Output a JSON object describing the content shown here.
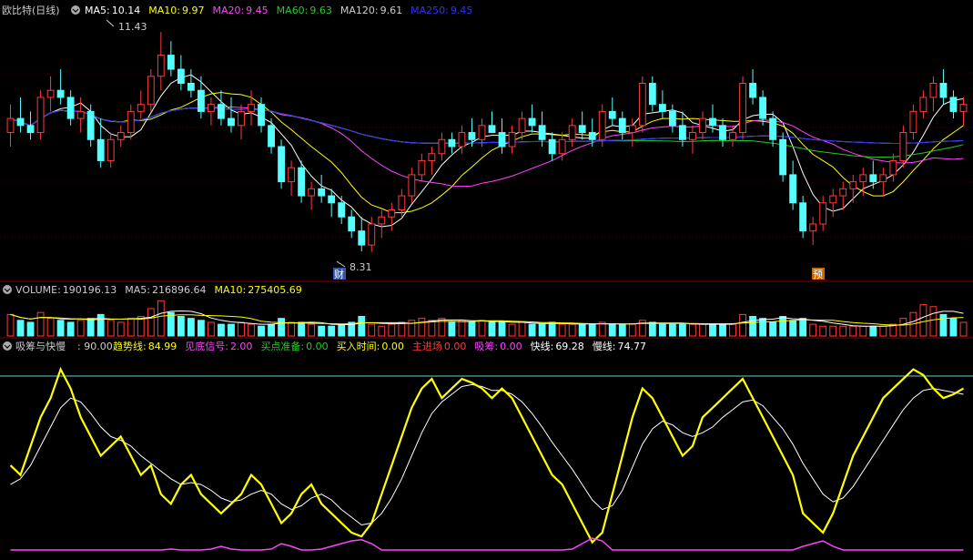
{
  "colors": {
    "up": "#ff3a3a",
    "down": "#54ffff",
    "ma5": "#ffffff",
    "ma10": "#ffff00",
    "ma20": "#ff44ff",
    "ma60": "#22cc22",
    "ma120": "#cccccc",
    "ma250": "#3030ff",
    "fast": "#ffff00",
    "slow": "#ffffff",
    "volume_line1": "#ffffff",
    "volume_line2": "#ffff00",
    "grid": "#800000",
    "hline": "#66cccc"
  },
  "price_panel": {
    "title": "欧比特(日线)",
    "indicators": [
      {
        "label": "MA5:",
        "value": "10.14",
        "color": "#ffffff"
      },
      {
        "label": "MA10:",
        "value": "9.97",
        "color": "#ffff00"
      },
      {
        "label": "MA20:",
        "value": "9.45",
        "color": "#ff44ff"
      },
      {
        "label": "MA60:",
        "value": "9.63",
        "color": "#22cc22"
      },
      {
        "label": "MA120:",
        "value": "9.61",
        "color": "#cccccc"
      },
      {
        "label": "MA250:",
        "value": "9.45",
        "color": "#3030ff"
      }
    ],
    "high_label": "11.43",
    "low_label": "8.31",
    "marker_cai": "财",
    "marker_yu": "预"
  },
  "volume_panel": {
    "indicators": [
      {
        "label": "VOLUME:",
        "value": "190196.13",
        "color": "#cccccc"
      },
      {
        "label": "MA5:",
        "value": "216896.64",
        "color": "#cccccc"
      },
      {
        "label": "MA10:",
        "value": "275405.69",
        "color": "#ffff00"
      }
    ]
  },
  "signal_panel": {
    "title": "吸筹与快慢",
    "title_value": ": 90.00",
    "indicators": [
      {
        "label": "趋势线:",
        "value": "84.99",
        "color": "#ffff00"
      },
      {
        "label": "见底信号:",
        "value": "2.00",
        "color": "#ff44ff"
      },
      {
        "label": "买点准备:",
        "value": "0.00",
        "color": "#22cc22"
      },
      {
        "label": "买入时间:",
        "value": "0.00",
        "color": "#ffff00"
      },
      {
        "label": "主进场",
        "value": "0.00",
        "color": "#ff3a3a"
      },
      {
        "label": "吸筹:",
        "value": "0.00",
        "color": "#ff44ff"
      },
      {
        "label": "快线:",
        "value": "69.28",
        "color": "#ffffff"
      },
      {
        "label": "慢线:",
        "value": "74.77",
        "color": "#ffffff"
      }
    ]
  },
  "chart_data": {
    "type": "candlestick",
    "price_range": [
      8.0,
      11.6
    ],
    "high": 11.43,
    "low": 8.31,
    "candles": [
      [
        10.0,
        10.4,
        9.8,
        10.2
      ],
      [
        10.2,
        10.5,
        10.0,
        10.1
      ],
      [
        10.1,
        10.3,
        9.9,
        10.0
      ],
      [
        10.0,
        10.6,
        9.9,
        10.5
      ],
      [
        10.5,
        10.8,
        10.3,
        10.6
      ],
      [
        10.6,
        10.9,
        10.4,
        10.5
      ],
      [
        10.5,
        10.6,
        10.1,
        10.2
      ],
      [
        10.2,
        10.5,
        10.0,
        10.3
      ],
      [
        10.3,
        10.4,
        9.8,
        9.9
      ],
      [
        9.9,
        10.2,
        9.5,
        9.6
      ],
      [
        9.6,
        10.0,
        9.5,
        9.9
      ],
      [
        9.9,
        10.1,
        9.8,
        10.0
      ],
      [
        10.0,
        10.4,
        9.9,
        10.3
      ],
      [
        10.3,
        10.6,
        10.2,
        10.4
      ],
      [
        10.4,
        10.9,
        10.3,
        10.8
      ],
      [
        10.8,
        11.43,
        10.6,
        11.1
      ],
      [
        11.1,
        11.3,
        10.8,
        10.9
      ],
      [
        10.9,
        11.1,
        10.6,
        10.7
      ],
      [
        10.7,
        10.9,
        10.5,
        10.6
      ],
      [
        10.6,
        10.8,
        10.2,
        10.3
      ],
      [
        10.3,
        10.5,
        10.1,
        10.4
      ],
      [
        10.4,
        10.6,
        10.1,
        10.2
      ],
      [
        10.2,
        10.5,
        10.0,
        10.1
      ],
      [
        10.1,
        10.4,
        9.9,
        10.3
      ],
      [
        10.3,
        10.6,
        10.1,
        10.4
      ],
      [
        10.4,
        10.5,
        10.0,
        10.1
      ],
      [
        10.1,
        10.2,
        9.7,
        9.8
      ],
      [
        9.8,
        9.9,
        9.2,
        9.3
      ],
      [
        9.3,
        9.6,
        9.1,
        9.5
      ],
      [
        9.5,
        9.6,
        9.0,
        9.1
      ],
      [
        9.1,
        9.3,
        8.9,
        9.2
      ],
      [
        9.2,
        9.4,
        9.0,
        9.1
      ],
      [
        9.1,
        9.2,
        8.8,
        9.0
      ],
      [
        9.0,
        9.1,
        8.7,
        8.8
      ],
      [
        8.8,
        8.9,
        8.5,
        8.6
      ],
      [
        8.6,
        8.8,
        8.31,
        8.4
      ],
      [
        8.4,
        8.8,
        8.3,
        8.7
      ],
      [
        8.7,
        8.9,
        8.5,
        8.8
      ],
      [
        8.8,
        9.0,
        8.6,
        8.9
      ],
      [
        8.9,
        9.2,
        8.8,
        9.1
      ],
      [
        9.1,
        9.5,
        9.0,
        9.4
      ],
      [
        9.4,
        9.7,
        9.3,
        9.6
      ],
      [
        9.6,
        9.8,
        9.4,
        9.7
      ],
      [
        9.7,
        10.0,
        9.6,
        9.9
      ],
      [
        9.9,
        10.0,
        9.7,
        9.8
      ],
      [
        9.8,
        10.1,
        9.7,
        10.0
      ],
      [
        10.0,
        10.2,
        9.8,
        9.9
      ],
      [
        9.9,
        10.2,
        9.8,
        10.1
      ],
      [
        10.1,
        10.3,
        10.0,
        10.0
      ],
      [
        10.0,
        10.2,
        9.7,
        9.8
      ],
      [
        9.8,
        10.1,
        9.7,
        10.0
      ],
      [
        10.0,
        10.3,
        9.9,
        10.2
      ],
      [
        10.2,
        10.4,
        10.0,
        10.1
      ],
      [
        10.1,
        10.3,
        9.8,
        9.9
      ],
      [
        9.9,
        10.0,
        9.6,
        9.7
      ],
      [
        9.7,
        10.0,
        9.6,
        9.9
      ],
      [
        9.9,
        10.2,
        9.8,
        10.1
      ],
      [
        10.1,
        10.3,
        9.9,
        10.0
      ],
      [
        10.0,
        10.2,
        9.8,
        9.9
      ],
      [
        9.9,
        10.4,
        9.8,
        10.3
      ],
      [
        10.3,
        10.5,
        10.1,
        10.2
      ],
      [
        10.2,
        10.3,
        9.9,
        10.0
      ],
      [
        10.0,
        10.2,
        9.8,
        10.1
      ],
      [
        10.1,
        10.8,
        10.0,
        10.7
      ],
      [
        10.7,
        10.8,
        10.3,
        10.4
      ],
      [
        10.4,
        10.6,
        10.2,
        10.3
      ],
      [
        10.3,
        10.4,
        10.0,
        10.1
      ],
      [
        10.1,
        10.3,
        9.8,
        9.9
      ],
      [
        9.9,
        10.1,
        9.7,
        10.0
      ],
      [
        10.0,
        10.3,
        9.9,
        10.2
      ],
      [
        10.2,
        10.4,
        10.0,
        10.1
      ],
      [
        10.1,
        10.2,
        9.8,
        9.9
      ],
      [
        9.9,
        10.1,
        9.8,
        10.0
      ],
      [
        10.0,
        10.8,
        9.9,
        10.7
      ],
      [
        10.7,
        10.9,
        10.4,
        10.5
      ],
      [
        10.5,
        10.6,
        10.1,
        10.2
      ],
      [
        10.2,
        10.3,
        9.8,
        9.9
      ],
      [
        9.9,
        10.0,
        9.3,
        9.4
      ],
      [
        9.4,
        9.6,
        8.9,
        9.0
      ],
      [
        9.0,
        9.1,
        8.5,
        8.6
      ],
      [
        8.6,
        8.8,
        8.4,
        8.7
      ],
      [
        8.7,
        9.1,
        8.6,
        9.0
      ],
      [
        9.0,
        9.2,
        8.8,
        9.1
      ],
      [
        9.1,
        9.3,
        8.9,
        9.2
      ],
      [
        9.2,
        9.4,
        9.0,
        9.3
      ],
      [
        9.3,
        9.5,
        9.1,
        9.4
      ],
      [
        9.4,
        9.6,
        9.2,
        9.3
      ],
      [
        9.3,
        9.5,
        9.1,
        9.4
      ],
      [
        9.4,
        9.7,
        9.3,
        9.6
      ],
      [
        9.6,
        10.1,
        9.5,
        10.0
      ],
      [
        10.0,
        10.4,
        9.9,
        10.3
      ],
      [
        10.3,
        10.6,
        10.2,
        10.5
      ],
      [
        10.5,
        10.8,
        10.3,
        10.7
      ],
      [
        10.7,
        10.9,
        10.4,
        10.5
      ],
      [
        10.5,
        10.6,
        10.2,
        10.3
      ],
      [
        10.3,
        10.5,
        10.1,
        10.4
      ]
    ],
    "volumes": [
      0.55,
      0.4,
      0.35,
      0.6,
      0.45,
      0.4,
      0.35,
      0.4,
      0.45,
      0.55,
      0.4,
      0.35,
      0.45,
      0.5,
      0.7,
      0.9,
      0.6,
      0.5,
      0.45,
      0.4,
      0.35,
      0.3,
      0.3,
      0.35,
      0.3,
      0.25,
      0.3,
      0.45,
      0.35,
      0.35,
      0.3,
      0.25,
      0.25,
      0.3,
      0.35,
      0.5,
      0.3,
      0.25,
      0.3,
      0.35,
      0.4,
      0.45,
      0.4,
      0.45,
      0.35,
      0.4,
      0.35,
      0.4,
      0.35,
      0.35,
      0.3,
      0.35,
      0.3,
      0.3,
      0.35,
      0.3,
      0.3,
      0.3,
      0.3,
      0.35,
      0.3,
      0.3,
      0.3,
      0.4,
      0.35,
      0.3,
      0.3,
      0.3,
      0.3,
      0.3,
      0.3,
      0.3,
      0.3,
      0.55,
      0.5,
      0.45,
      0.35,
      0.5,
      0.4,
      0.45,
      0.3,
      0.25,
      0.25,
      0.25,
      0.25,
      0.25,
      0.25,
      0.25,
      0.3,
      0.45,
      0.6,
      0.8,
      0.75,
      0.55,
      0.45,
      0.35
    ],
    "fast_line": [
      45,
      40,
      55,
      70,
      80,
      95,
      85,
      70,
      60,
      50,
      55,
      60,
      50,
      40,
      45,
      30,
      25,
      35,
      40,
      30,
      25,
      20,
      25,
      30,
      40,
      35,
      25,
      15,
      20,
      30,
      35,
      25,
      20,
      15,
      10,
      8,
      15,
      30,
      45,
      60,
      75,
      85,
      90,
      80,
      85,
      90,
      88,
      85,
      80,
      85,
      80,
      70,
      60,
      50,
      40,
      35,
      25,
      15,
      5,
      10,
      30,
      50,
      70,
      85,
      80,
      70,
      60,
      50,
      55,
      70,
      75,
      80,
      85,
      90,
      80,
      70,
      60,
      50,
      40,
      20,
      15,
      10,
      20,
      35,
      50,
      60,
      70,
      80,
      85,
      90,
      95,
      92,
      85,
      80,
      82,
      85
    ],
    "slow_line": [
      35,
      38,
      45,
      55,
      65,
      75,
      80,
      78,
      72,
      65,
      60,
      58,
      55,
      50,
      46,
      42,
      38,
      35,
      36,
      35,
      32,
      28,
      26,
      27,
      30,
      32,
      30,
      25,
      22,
      24,
      28,
      30,
      27,
      22,
      18,
      14,
      15,
      20,
      28,
      38,
      50,
      62,
      72,
      78,
      82,
      86,
      87,
      86,
      84,
      84,
      82,
      78,
      72,
      65,
      57,
      50,
      43,
      35,
      27,
      22,
      24,
      32,
      44,
      56,
      64,
      68,
      66,
      62,
      60,
      62,
      65,
      70,
      74,
      78,
      79,
      76,
      70,
      64,
      56,
      46,
      38,
      30,
      26,
      28,
      34,
      42,
      50,
      58,
      66,
      74,
      80,
      84,
      85,
      84,
      83,
      82
    ]
  }
}
